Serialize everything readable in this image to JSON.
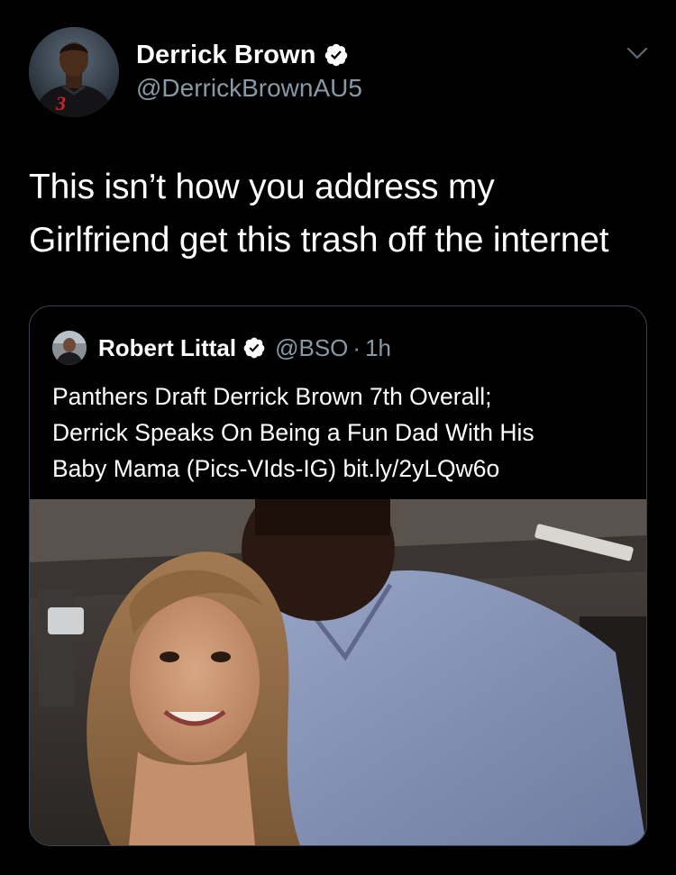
{
  "tweet": {
    "author_name": "Derrick Brown",
    "author_handle": "@DerrickBrownAU5",
    "text_lines": [
      "This isn’t how you address my",
      "Girlfriend get this trash off the internet"
    ],
    "jersey_number": "3"
  },
  "quoted_tweet": {
    "author_name": "Robert Littal",
    "author_handle": "@BSO",
    "separator": "·",
    "time": "1h",
    "text_lines": [
      "Panthers Draft Derrick Brown 7th Overall;",
      "Derrick Speaks On Being a Fun Dad With His",
      "Baby Mama (Pics-VIds-IG) bit.ly/2yLQw6o"
    ]
  },
  "icons": {
    "verified": "verified-badge-icon",
    "menu": "chevron-down-icon"
  },
  "colors": {
    "background": "#000000",
    "text_primary": "#ffffff",
    "text_secondary": "#8899a6",
    "border": "#38444d",
    "verified_badge": "#ffffff"
  }
}
